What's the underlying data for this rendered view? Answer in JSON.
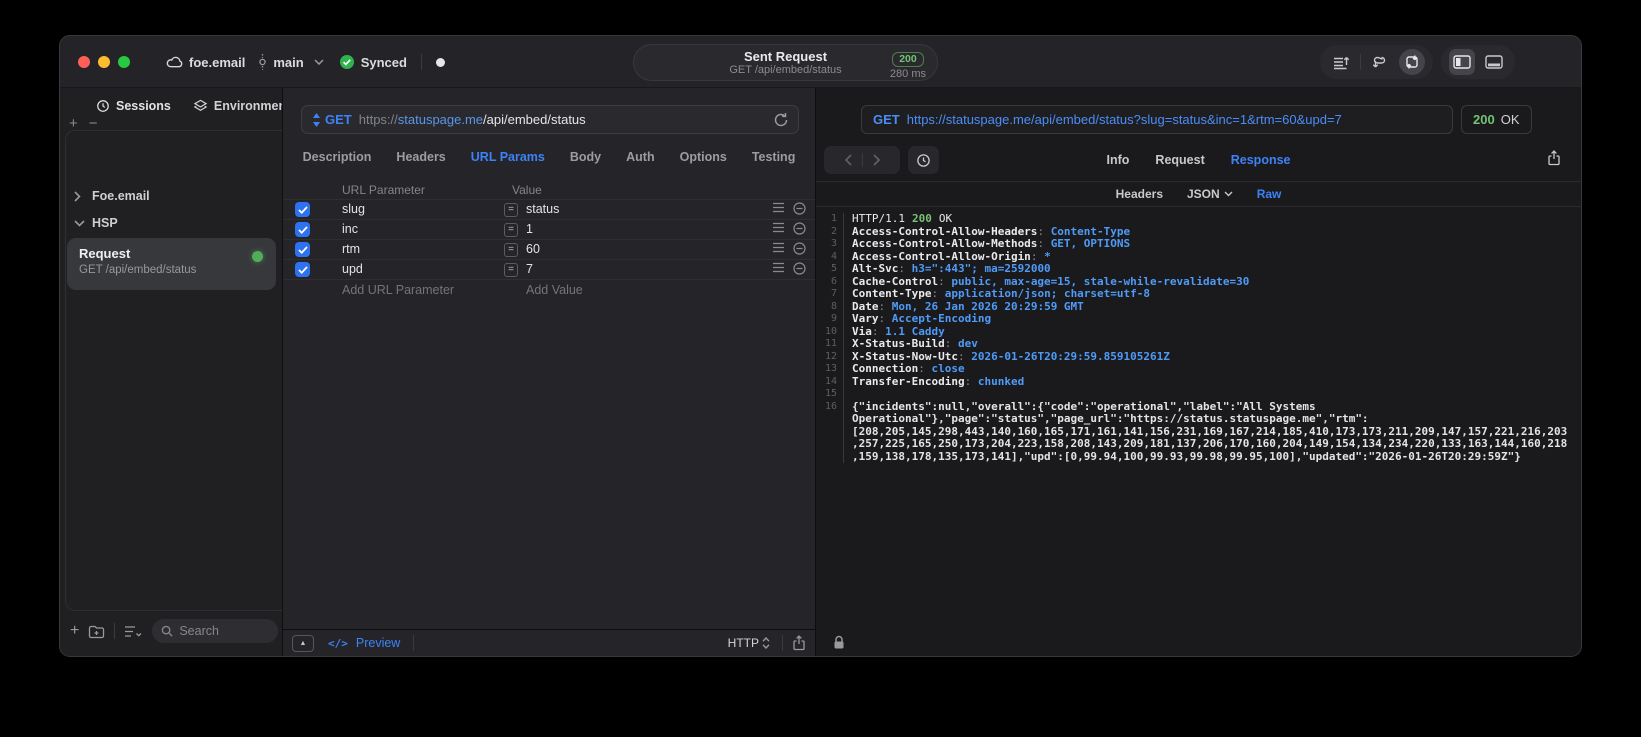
{
  "colors": {
    "accent_blue": "#3d82f7",
    "status_green": "#74c274",
    "checkbox_blue": "#2e72f0"
  },
  "titlebar": {
    "project": "foe.email",
    "branch": "main",
    "sync_status": "Synced",
    "request_title": "Sent Request",
    "request_subtitle": "GET /api/embed/status",
    "status_code": "200",
    "duration": "280 ms"
  },
  "sidebar": {
    "tabs": [
      {
        "label": "Sessions"
      },
      {
        "label": "Environments"
      }
    ],
    "add_label": "+",
    "remove_label": "−",
    "tree": [
      {
        "label": "Foe.email"
      },
      {
        "label": "HSP"
      }
    ],
    "request_item": {
      "title": "Request",
      "subtitle": "GET /api/embed/status"
    },
    "footer_add": "+",
    "search_placeholder": "Search"
  },
  "request_pane": {
    "method": "GET",
    "url_protocol": "https://",
    "url_host": "statuspage.me",
    "url_path": "/api/embed/status",
    "tabs": [
      "Description",
      "Headers",
      "URL Params",
      "Body",
      "Auth",
      "Options",
      "Testing"
    ],
    "active_tab": "URL Params",
    "params": {
      "col_param": "URL Parameter",
      "col_value": "Value",
      "rows": [
        {
          "name": "slug",
          "op": "=",
          "value": "status"
        },
        {
          "name": "inc",
          "op": "=",
          "value": "1"
        },
        {
          "name": "rtm",
          "op": "=",
          "value": "60"
        },
        {
          "name": "upd",
          "op": "=",
          "value": "7"
        }
      ],
      "add_param": "Add URL Parameter",
      "add_value": "Add Value"
    },
    "footer": {
      "collapse": "▲",
      "code": "</>",
      "preview": "Preview",
      "protocol": "HTTP"
    }
  },
  "response_pane": {
    "method": "GET",
    "url": "https://statuspage.me/api/embed/status?slug=status&inc=1&rtm=60&upd=7",
    "status_code": "200",
    "status_text": "OK",
    "tabs": [
      "Info",
      "Request",
      "Response"
    ],
    "active_tab": "Response",
    "subtabs": [
      "Headers",
      "JSON",
      "Raw"
    ],
    "active_subtab": "Raw",
    "status_line": {
      "n": "1",
      "protocol": "HTTP/1.1",
      "code": "200",
      "text": "OK"
    },
    "headers": [
      {
        "n": "2",
        "name": "Access-Control-Allow-Headers",
        "value": "Content-Type"
      },
      {
        "n": "3",
        "name": "Access-Control-Allow-Methods",
        "value": "GET, OPTIONS"
      },
      {
        "n": "4",
        "name": "Access-Control-Allow-Origin",
        "value": "*"
      },
      {
        "n": "5",
        "name": "Alt-Svc",
        "value": "h3=\":443\"; ma=2592000"
      },
      {
        "n": "6",
        "name": "Cache-Control",
        "value": "public, max-age=15, stale-while-revalidate=30"
      },
      {
        "n": "7",
        "name": "Content-Type",
        "value": "application/json; charset=utf-8"
      },
      {
        "n": "8",
        "name": "Date",
        "value": "Mon, 26 Jan 2026 20:29:59 GMT"
      },
      {
        "n": "9",
        "name": "Vary",
        "value": "Accept-Encoding"
      },
      {
        "n": "10",
        "name": "Via",
        "value": "1.1 Caddy"
      },
      {
        "n": "11",
        "name": "X-Status-Build",
        "value": "dev"
      },
      {
        "n": "12",
        "name": "X-Status-Now-Utc",
        "value": "2026-01-26T20:29:59.859105261Z"
      },
      {
        "n": "13",
        "name": "Connection",
        "value": "close"
      },
      {
        "n": "14",
        "name": "Transfer-Encoding",
        "value": "chunked"
      }
    ],
    "blank_line_n": "15",
    "body_line": {
      "n": "16",
      "text": "{\"incidents\":null,\"overall\":{\"code\":\"operational\",\"label\":\"All Systems Operational\"},\"page\":\"status\",\"page_url\":\"https://status.statuspage.me\",\"rtm\":[208,205,145,298,443,140,160,165,171,161,141,156,231,169,167,214,185,410,173,173,211,209,147,157,221,216,203,257,225,165,250,173,204,223,158,208,143,209,181,137,206,170,160,204,149,154,134,234,220,133,163,144,160,218,159,138,178,135,173,141],\"upd\":[0,99.94,100,99.93,99.98,99.95,100],\"updated\":\"2026-01-26T20:29:59Z\"}"
    }
  }
}
